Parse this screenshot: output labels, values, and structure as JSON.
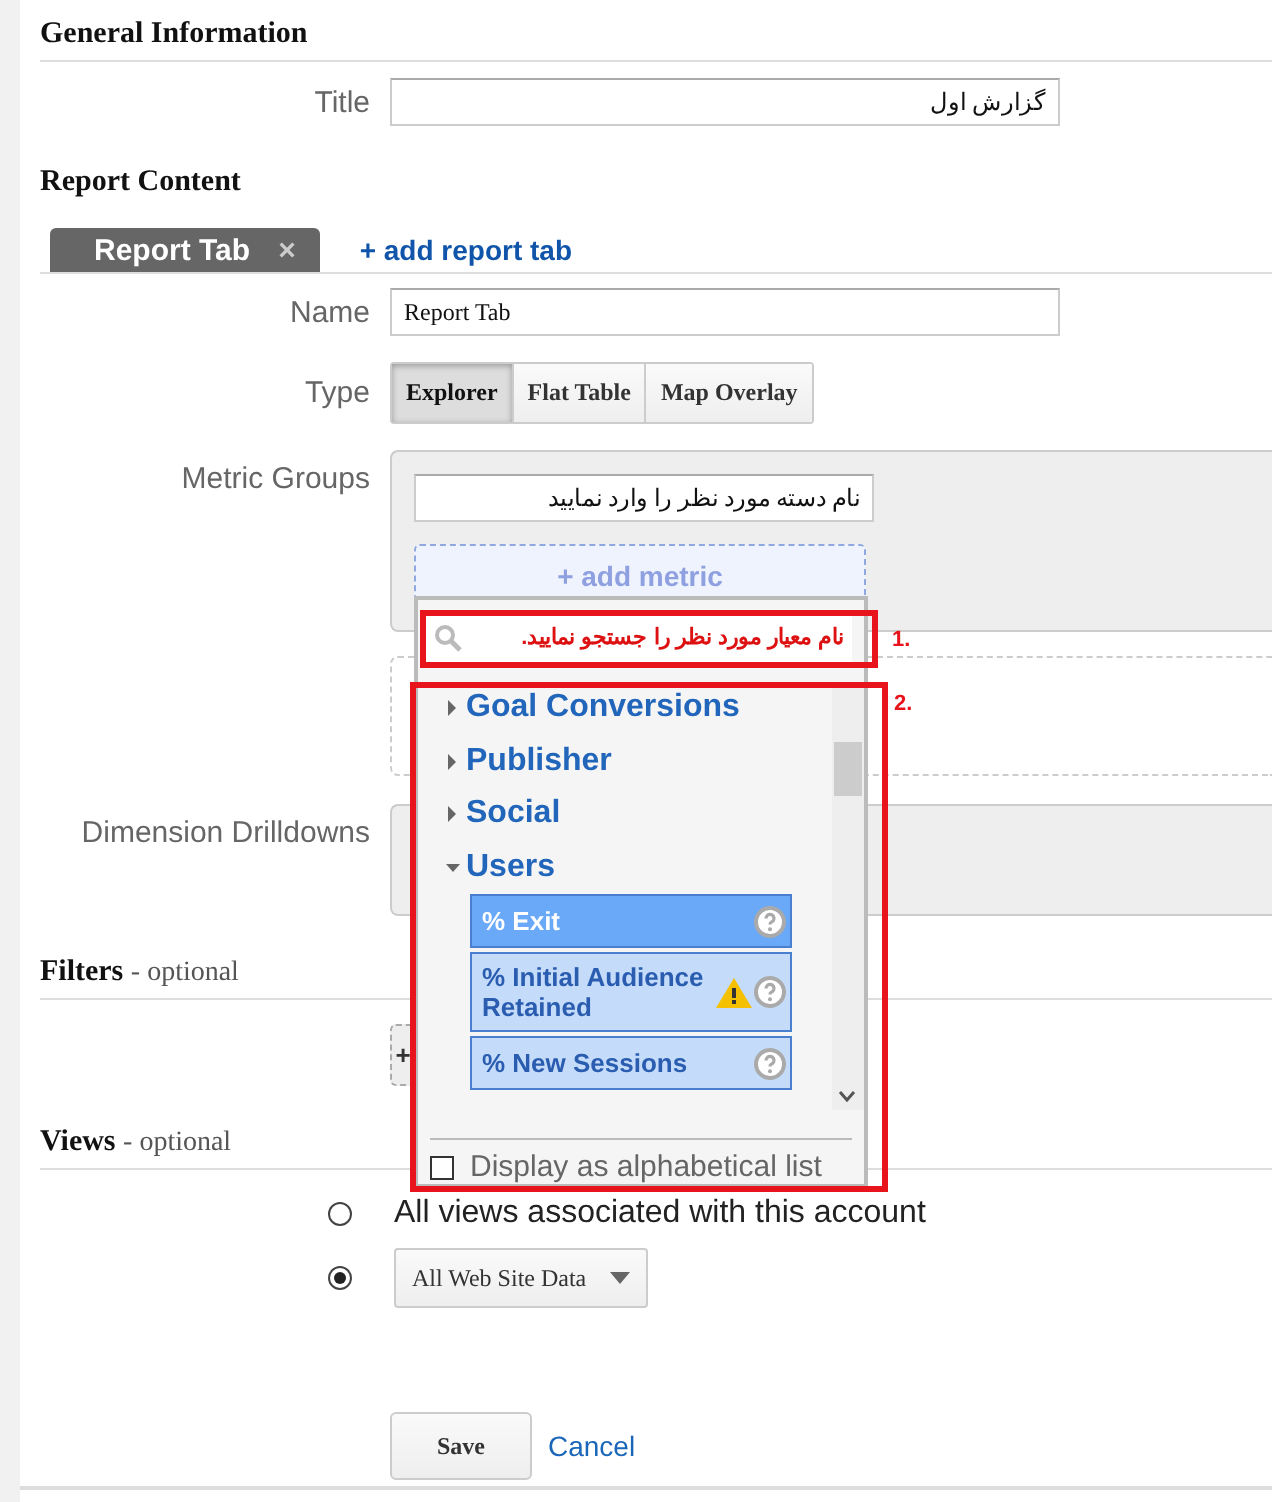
{
  "general": {
    "heading": "General Information",
    "title_label": "Title",
    "title_value": "گزارش اول"
  },
  "report_content": {
    "heading": "Report Content",
    "tabs": [
      {
        "label": "Report Tab",
        "selected": true,
        "close": "×"
      }
    ],
    "add_tab": "+ add report tab",
    "name_label": "Name",
    "name_value": "Report Tab",
    "type_label": "Type",
    "types": [
      {
        "label": "Explorer",
        "selected": true
      },
      {
        "label": "Flat Table",
        "selected": false
      },
      {
        "label": "Map Overlay",
        "selected": false
      }
    ],
    "metric_groups_label": "Metric Groups",
    "group_name_value": "نام دسته مورد نظر را وارد نمایید",
    "add_metric": "+ add metric",
    "dimension_label": "Dimension Drilldowns"
  },
  "metric_dropdown": {
    "search_placeholder": "نام معیار مورد نظر را جستجو نمایید.",
    "categories": [
      {
        "label": "Goal Conversions",
        "expanded": false
      },
      {
        "label": "Publisher",
        "expanded": false
      },
      {
        "label": "Social",
        "expanded": false
      },
      {
        "label": "Users",
        "expanded": true,
        "children": [
          {
            "label": "% Exit",
            "selected": true,
            "warning": false
          },
          {
            "label": "% Initial Audience Retained",
            "selected": false,
            "warning": true
          },
          {
            "label": "% New Sessions",
            "selected": false,
            "warning": false
          }
        ]
      }
    ],
    "alphabetical": {
      "label": "Display as alphabetical list",
      "checked": false
    }
  },
  "annotations": [
    {
      "label": "1."
    },
    {
      "label": "2."
    }
  ],
  "filters": {
    "heading": "Filters",
    "note": "- optional",
    "button": "+"
  },
  "views": {
    "heading": "Views",
    "note": "- optional",
    "options": [
      {
        "kind": "text",
        "label": "All views associated with this account",
        "selected": false
      },
      {
        "kind": "select",
        "value": "All Web Site Data",
        "selected": true
      }
    ]
  },
  "actions": {
    "save": "Save",
    "cancel": "Cancel"
  }
}
